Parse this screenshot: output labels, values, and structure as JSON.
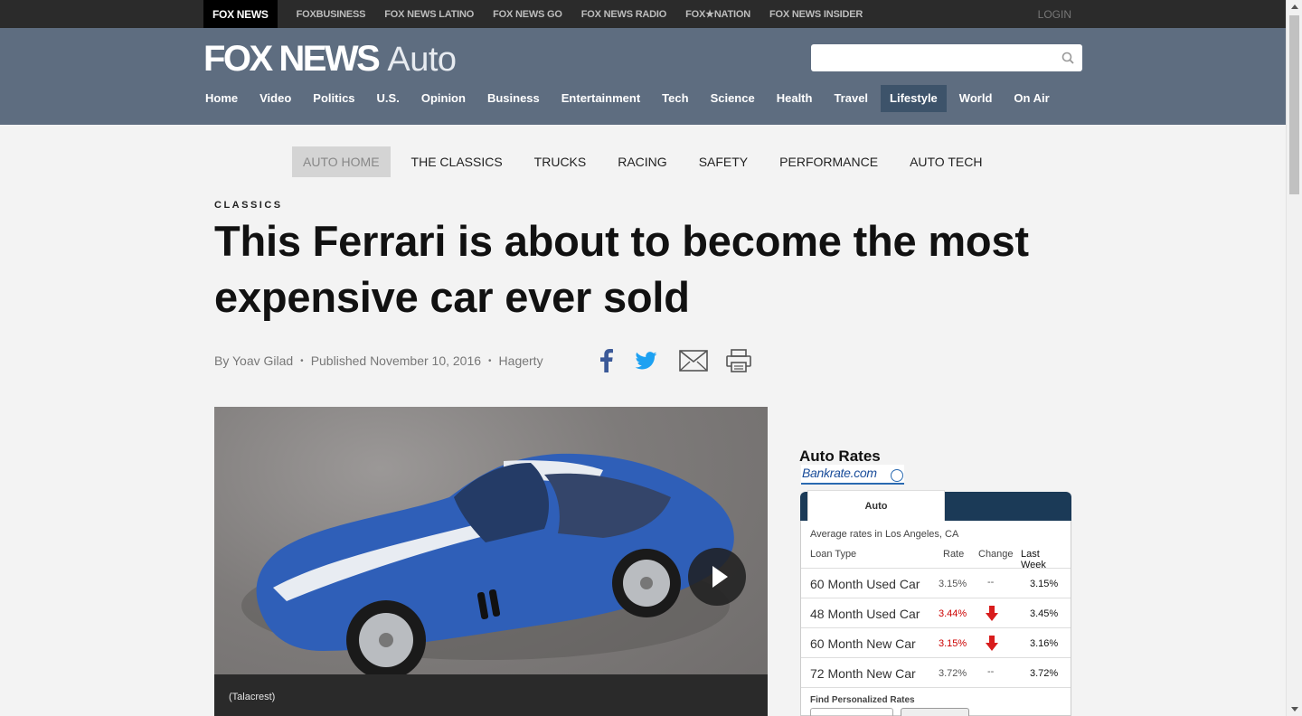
{
  "network": {
    "brand": "FOX NEWS",
    "links": [
      "FOXBUSINESS",
      "FOX NEWS latino",
      "FOX NEWS GO",
      "FOX NEWS RADIO",
      "FOX★NATION",
      "FOX NEWS INSIDER"
    ],
    "login": "LOGIN"
  },
  "header": {
    "logo_main": "FOX NEWS",
    "logo_section": "Auto",
    "search_placeholder": "",
    "nav": [
      "Home",
      "Video",
      "Politics",
      "U.S.",
      "Opinion",
      "Business",
      "Entertainment",
      "Tech",
      "Science",
      "Health",
      "Travel",
      "Lifestyle",
      "World",
      "On Air"
    ],
    "active_nav": "Lifestyle"
  },
  "subnav": {
    "items": [
      "AUTO HOME",
      "THE CLASSICS",
      "TRUCKS",
      "RACING",
      "SAFETY",
      "PERFORMANCE",
      "AUTO TECH"
    ],
    "active": "AUTO HOME"
  },
  "article": {
    "eyebrow": "CLASSICS",
    "headline": "This Ferrari is about to become the most expensive car ever sold",
    "author": "By Yoav Gilad",
    "published": "Published November 10, 2016",
    "source": "Hagerty",
    "share_icons": [
      "facebook-icon",
      "twitter-icon",
      "email-icon",
      "print-icon"
    ],
    "image_caption": "(Talacrest)"
  },
  "rates": {
    "title": "Auto Rates",
    "provider": "Bankrate.com",
    "tab": "Auto",
    "location": "Average rates in Los Angeles, CA",
    "columns": {
      "type": "Loan Type",
      "rate": "Rate",
      "change": "Change",
      "last_week": "Last Week"
    },
    "rows": [
      {
        "type": "60 Month Used Car",
        "rate": "3.15%",
        "change": "--",
        "last_week": "3.15%",
        "direction": "none"
      },
      {
        "type": "48 Month Used Car",
        "rate": "3.44%",
        "change": "",
        "last_week": "3.45%",
        "direction": "down"
      },
      {
        "type": "60 Month New Car",
        "rate": "3.15%",
        "change": "",
        "last_week": "3.16%",
        "direction": "down"
      },
      {
        "type": "72 Month New Car",
        "rate": "3.72%",
        "change": "--",
        "last_week": "3.72%",
        "direction": "none"
      }
    ],
    "find_label": "Find Personalized Rates"
  },
  "colors": {
    "header_bg": "#5e6d80",
    "active_nav_bg": "#3d536a",
    "rate_down": "#cc0000",
    "rates_header": "#1b3a57"
  }
}
